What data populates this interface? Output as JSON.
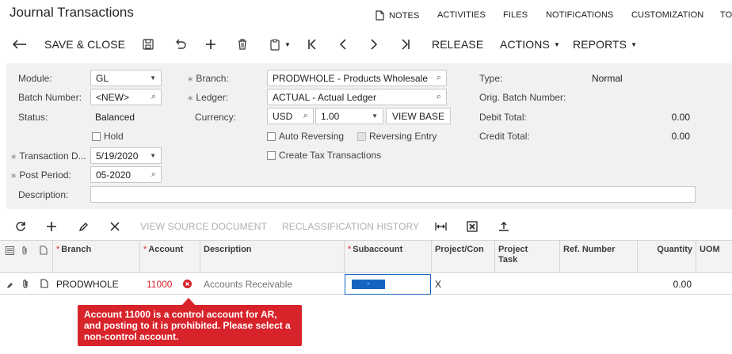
{
  "header": {
    "title": "Journal Transactions",
    "links": [
      "NOTES",
      "ACTIVITIES",
      "FILES",
      "NOTIFICATIONS",
      "CUSTOMIZATION",
      "TO"
    ]
  },
  "toolbar": {
    "save_close": "SAVE & CLOSE",
    "release": "RELEASE",
    "actions": "ACTIONS",
    "reports": "REPORTS"
  },
  "form": {
    "module_label": "Module:",
    "module_value": "GL",
    "batch_label": "Batch Number:",
    "batch_value": "<NEW>",
    "status_label": "Status:",
    "status_value": "Balanced",
    "hold_label": "Hold",
    "trans_date_label": "Transaction D...",
    "trans_date_value": "5/19/2020",
    "post_period_label": "Post Period:",
    "post_period_value": "05-2020",
    "description_label": "Description:",
    "description_value": "",
    "branch_label": "Branch:",
    "branch_value": "PRODWHOLE - Products Wholesale",
    "ledger_label": "Ledger:",
    "ledger_value": "ACTUAL - Actual Ledger",
    "currency_label": "Currency:",
    "currency_value": "USD",
    "rate_value": "1.00",
    "view_base": "VIEW BASE",
    "auto_reversing": "Auto Reversing",
    "reversing_entry": "Reversing Entry",
    "create_tax": "Create Tax Transactions",
    "type_label": "Type:",
    "type_value": "Normal",
    "orig_batch_label": "Orig. Batch Number:",
    "orig_batch_value": "",
    "debit_label": "Debit Total:",
    "debit_value": "0.00",
    "credit_label": "Credit Total:",
    "credit_value": "0.00"
  },
  "grid_toolbar": {
    "view_source": "VIEW SOURCE DOCUMENT",
    "reclass_history": "RECLASSIFICATION HISTORY"
  },
  "grid": {
    "columns": {
      "branch": "Branch",
      "account": "Account",
      "description": "Description",
      "subaccount": "Subaccount",
      "project": "Project/Con",
      "project_task": "Project Task",
      "ref_number": "Ref. Number",
      "quantity": "Quantity",
      "uom": "UOM"
    },
    "row": {
      "branch": "PRODWHOLE",
      "account": "11000",
      "description": "Accounts Receivable",
      "subaccount": "-",
      "project": "X",
      "quantity": "0.00"
    }
  },
  "error_tooltip": "Account 11000 is a control account for AR, and posting to it is prohibited. Please select a non-control account.",
  "colors": {
    "error": "#d8232a",
    "selection": "#1565c0",
    "form_bg": "#f1f1f1"
  }
}
